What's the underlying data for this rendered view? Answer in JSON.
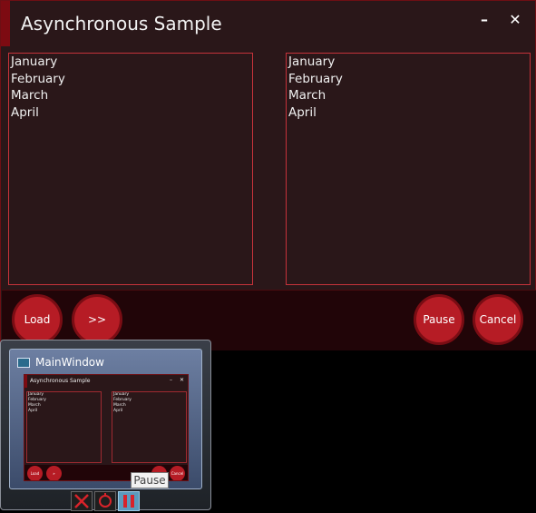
{
  "window": {
    "title": "Asynchronous Sample",
    "minimize_glyph": "–",
    "close_glyph": "✕"
  },
  "left_list": {
    "items": [
      "January",
      "February",
      "March",
      "April"
    ]
  },
  "right_list": {
    "items": [
      "January",
      "February",
      "March",
      "April"
    ]
  },
  "buttons": {
    "load": "Load",
    "next": ">>",
    "pause": "Pause",
    "cancel": "Cancel"
  },
  "thumbnail": {
    "title": "MainWindow",
    "mini_title": "Asynchronous Sample",
    "mini_min": "–",
    "mini_close": "✕",
    "mini_left_items": [
      "January",
      "February",
      "March",
      "April"
    ],
    "mini_right_items": [
      "January",
      "February",
      "March",
      "April"
    ],
    "mini_load": "Load",
    "mini_next": "»",
    "mini_cancel": "Cancel"
  },
  "tooltip": "Pause",
  "thumb_buttons": [
    {
      "icon": "cancel-x-icon",
      "color": "#d8232a"
    },
    {
      "icon": "circle-refresh-icon",
      "color": "#d8232a"
    },
    {
      "icon": "pause-icon",
      "color": "#d8232a"
    }
  ],
  "colors": {
    "window_bg": "#2a1719",
    "accent": "#7d0b12",
    "button_red": "#b61c25",
    "list_border": "#c5323a"
  }
}
